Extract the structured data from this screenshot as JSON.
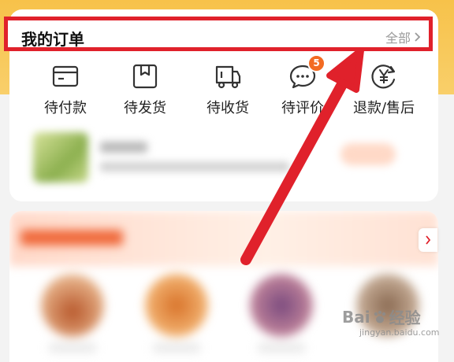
{
  "orders": {
    "title": "我的订单",
    "view_all": "全部"
  },
  "status_items": [
    {
      "label": "待付款",
      "icon": "wallet-card-icon"
    },
    {
      "label": "待发货",
      "icon": "package-box-icon"
    },
    {
      "label": "待收货",
      "icon": "delivery-truck-icon"
    },
    {
      "label": "待评价",
      "icon": "chat-bubble-icon",
      "badge": "5"
    },
    {
      "label": "退款/售后",
      "icon": "refund-yen-icon"
    }
  ],
  "watermark": {
    "brand": "Bai",
    "brand_cn": "经验",
    "sub": "jingyan.baidu.com"
  },
  "colors": {
    "accent_red": "#e0212b",
    "badge_orange": "#f36b22",
    "top_band": "#f7c24a"
  }
}
